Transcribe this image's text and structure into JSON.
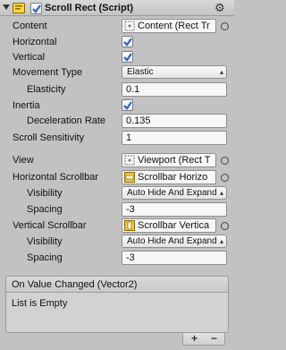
{
  "component": {
    "title": "Scroll Rect (Script)",
    "enabled": true
  },
  "fields": {
    "content": {
      "label": "Content",
      "value": "Content (Rect Tr"
    },
    "horizontal": {
      "label": "Horizontal",
      "checked": true
    },
    "vertical": {
      "label": "Vertical",
      "checked": true
    },
    "movement_type": {
      "label": "Movement Type",
      "value": "Elastic"
    },
    "elasticity": {
      "label": "Elasticity",
      "value": "0.1"
    },
    "inertia": {
      "label": "Inertia",
      "checked": true
    },
    "deceleration_rate": {
      "label": "Deceleration Rate",
      "value": "0.135"
    },
    "scroll_sensitivity": {
      "label": "Scroll Sensitivity",
      "value": "1"
    },
    "view": {
      "label": "View",
      "value": "Viewport (Rect T"
    },
    "horizontal_scrollbar": {
      "label": "Horizontal Scrollbar",
      "value": "Scrollbar Horizo"
    },
    "h_visibility": {
      "label": "Visibility",
      "value": "Auto Hide And Expand"
    },
    "h_spacing": {
      "label": "Spacing",
      "value": "-3"
    },
    "vertical_scrollbar": {
      "label": "Vertical Scrollbar",
      "value": "Scrollbar Vertica"
    },
    "v_visibility": {
      "label": "Visibility",
      "value": "Auto Hide And Expand"
    },
    "v_spacing": {
      "label": "Spacing",
      "value": "-3"
    }
  },
  "event": {
    "title": "On Value Changed (Vector2)",
    "empty_text": "List is Empty",
    "add_label": "+",
    "remove_label": "−"
  },
  "icons": {
    "fold": "triangle-down-icon",
    "component": "script-icon",
    "settings": "gear-icon",
    "object": "rect-transform-icon",
    "scrollbar": "scrollbar-icon",
    "picker": "object-picker-icon"
  },
  "colors": {
    "background": "#c2c2c2",
    "field_bg": "#f7f7f7",
    "check_blue": "#2a66c9"
  }
}
